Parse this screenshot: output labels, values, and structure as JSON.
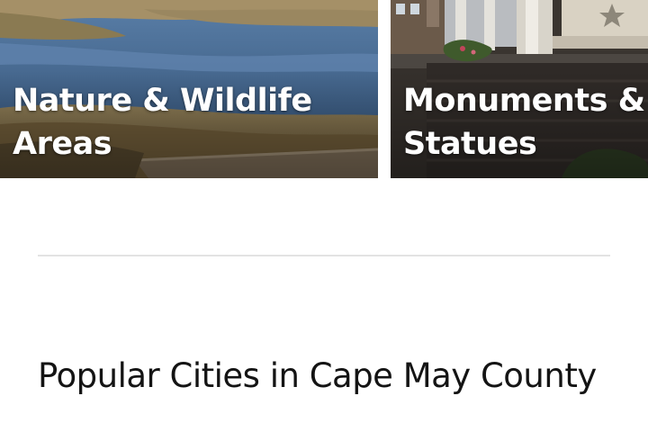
{
  "cards": [
    {
      "title_line1": "Nature & Wildlife",
      "title_line2": "Areas",
      "image": "marsh-landscape-photo"
    },
    {
      "title_line1": "Monuments &",
      "title_line2": "Statues",
      "image": "monument-plaza-photo"
    }
  ],
  "section": {
    "heading": "Popular Cities in Cape May County"
  },
  "colors": {
    "background": "#ffffff",
    "card_text": "#ffffff",
    "heading_text": "#141414",
    "divider": "#e3e3e3"
  }
}
